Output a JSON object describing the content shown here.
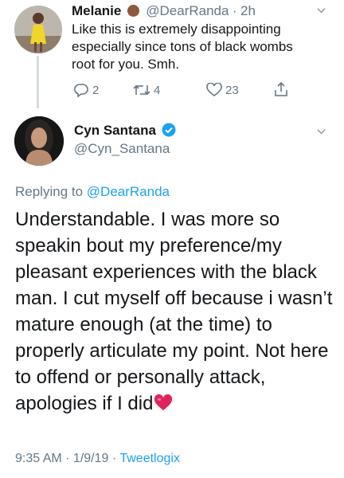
{
  "tweet1": {
    "name": "Melanie",
    "handle": "@DearRanda",
    "sep": "·",
    "time": "2h",
    "lines": [
      "Like this is extremely disappointing",
      "especially since tons of black wombs",
      "root for you. Smh."
    ],
    "reply_count": "2",
    "retweet_count": "4",
    "like_count": "23"
  },
  "tweet2": {
    "name": "Cyn Santana",
    "handle": "@Cyn_Santana",
    "replying_prefix": "Replying to ",
    "replying_mention": "@DearRanda",
    "lines": [
      "Understandable. I was more so",
      "speakin bout my preference/my",
      "pleasant experiences with the black",
      "man. I cut myself off because i wasn’t",
      "mature enough (at the time) to",
      "properly articulate my point. Not here",
      "to offend or personally attack,",
      "apologies if I did"
    ],
    "emoji": "❤️",
    "timestamp": "9:35 AM · 1/9/19 · ",
    "source": "Tweetlogix"
  },
  "colors": {
    "link": "#1da1f2",
    "muted": "#657786",
    "verified": "#1da1f2",
    "heart": "#e0245e"
  }
}
